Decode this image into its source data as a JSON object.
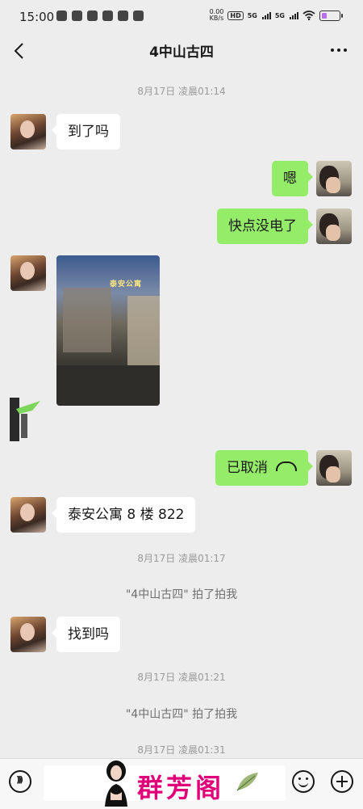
{
  "status_bar": {
    "time": "15:00",
    "net_speed_value": "0.00",
    "net_speed_unit": "KB/s",
    "hd_badge": "HD",
    "signal1_label": "5G",
    "signal2_label": "5G"
  },
  "header": {
    "title": "4中山古四"
  },
  "messages": {
    "time_1": "8月17日 凌晨01:14",
    "msg_1": "到了吗",
    "msg_2": "嗯",
    "msg_3": "快点没电了",
    "photo_sign": "泰安公寓",
    "msg_4": "已取消",
    "msg_5": "泰安公寓 8 楼 822",
    "time_2": "8月17日 凌晨01:17",
    "sys_1": "\"4中山古四\" 拍了拍我",
    "msg_6": "找到吗",
    "time_3": "8月17日 凌晨01:21",
    "sys_2": "\"4中山古四\" 拍了拍我",
    "time_4": "8月17日 凌晨01:31"
  },
  "watermark": {
    "text": "群芳阁"
  },
  "icons": {
    "back": "back-arrow-icon",
    "more": "more-dots-icon",
    "voice": "voice-icon",
    "emoji": "emoji-icon",
    "plus": "plus-icon",
    "call": "call-end-icon"
  },
  "colors": {
    "background": "#ededed",
    "bubble_out": "#95ec69",
    "bubble_in": "#ffffff",
    "watermark": "#e0007a"
  }
}
